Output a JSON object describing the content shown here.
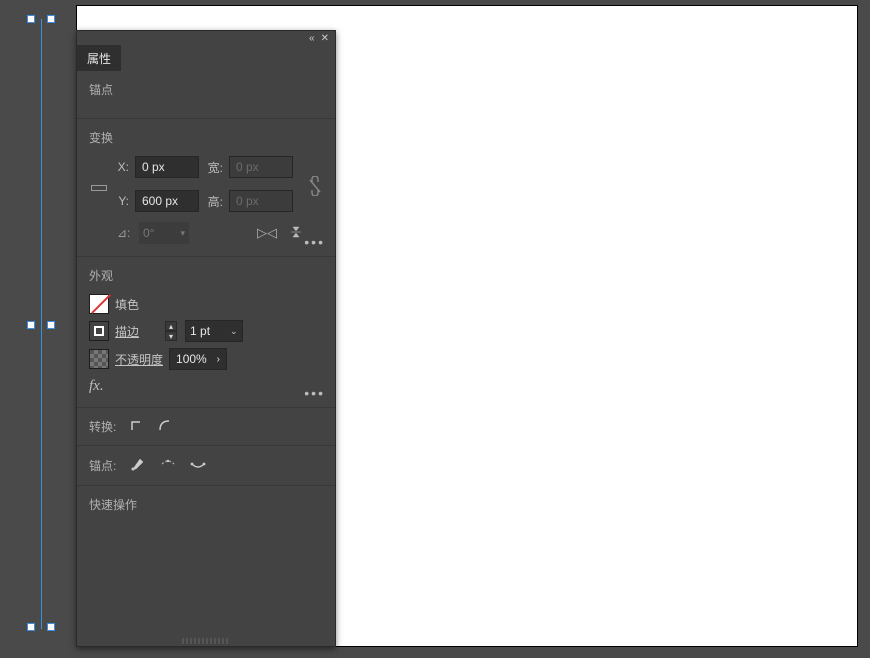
{
  "panel": {
    "tab_label": "属性",
    "anchor_section": "锚点",
    "transform_section": "变换",
    "x_label": "X:",
    "x_value": "0 px",
    "y_label": "Y:",
    "y_value": "600 px",
    "w_label": "宽:",
    "w_value": "0 px",
    "h_label": "高:",
    "h_value": "0 px",
    "angle_label": "⊿:",
    "angle_value": "0°",
    "appearance_section": "外观",
    "fill_label": "填色",
    "stroke_label": "描边",
    "stroke_value": "1 pt",
    "opacity_label": "不透明度",
    "opacity_value": "100%",
    "fx_label": "fx.",
    "convert_label": "转换:",
    "anchor_tools_label": "锚点:",
    "quick_label": "快速操作"
  }
}
